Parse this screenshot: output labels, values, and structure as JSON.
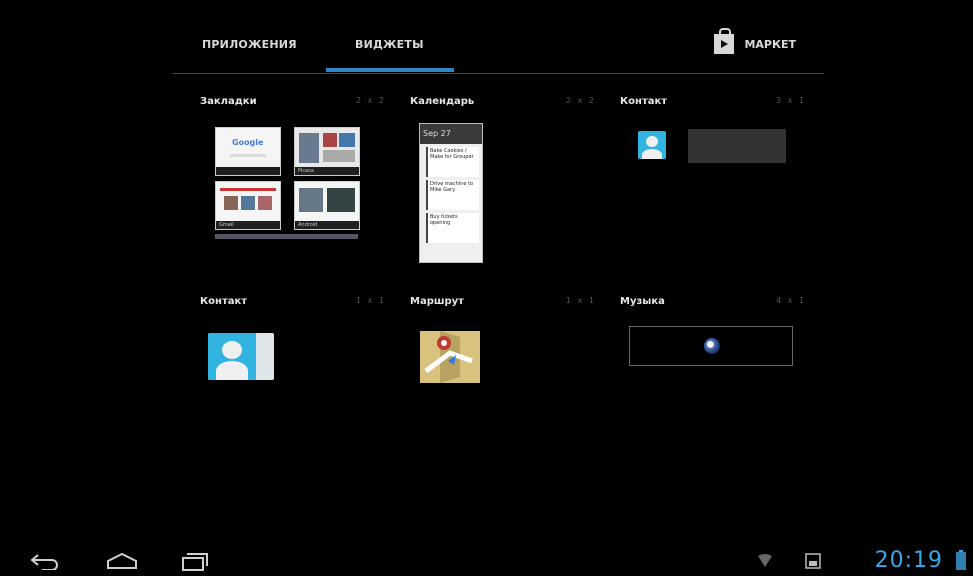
{
  "tabs": {
    "apps": "ПРИЛОЖЕНИЯ",
    "widgets": "ВИДЖЕТЫ",
    "market": "МАРКЕТ"
  },
  "widgets": [
    {
      "title": "Закладки",
      "size": "2 x 2"
    },
    {
      "title": "Календарь",
      "size": "2 x 2"
    },
    {
      "title": "Контакт",
      "size": "3 x 1"
    },
    {
      "title": "Контакт",
      "size": "1 x 1"
    },
    {
      "title": "Маршрут",
      "size": "1 x 1"
    },
    {
      "title": "Музыка",
      "size": "4 x 1"
    }
  ],
  "bookmarks": [
    "Google",
    "Picasa",
    "Gmail",
    "Android"
  ],
  "calendar": {
    "date": "Sep 27",
    "events": [
      "Bake Cookies / Make for Grouper",
      "Drive machine to Mike Gary",
      "Buy tickets opening"
    ]
  },
  "status": {
    "time": "20:19"
  },
  "colors": {
    "accent": "#2f86c8",
    "clock": "#39a8e6"
  }
}
